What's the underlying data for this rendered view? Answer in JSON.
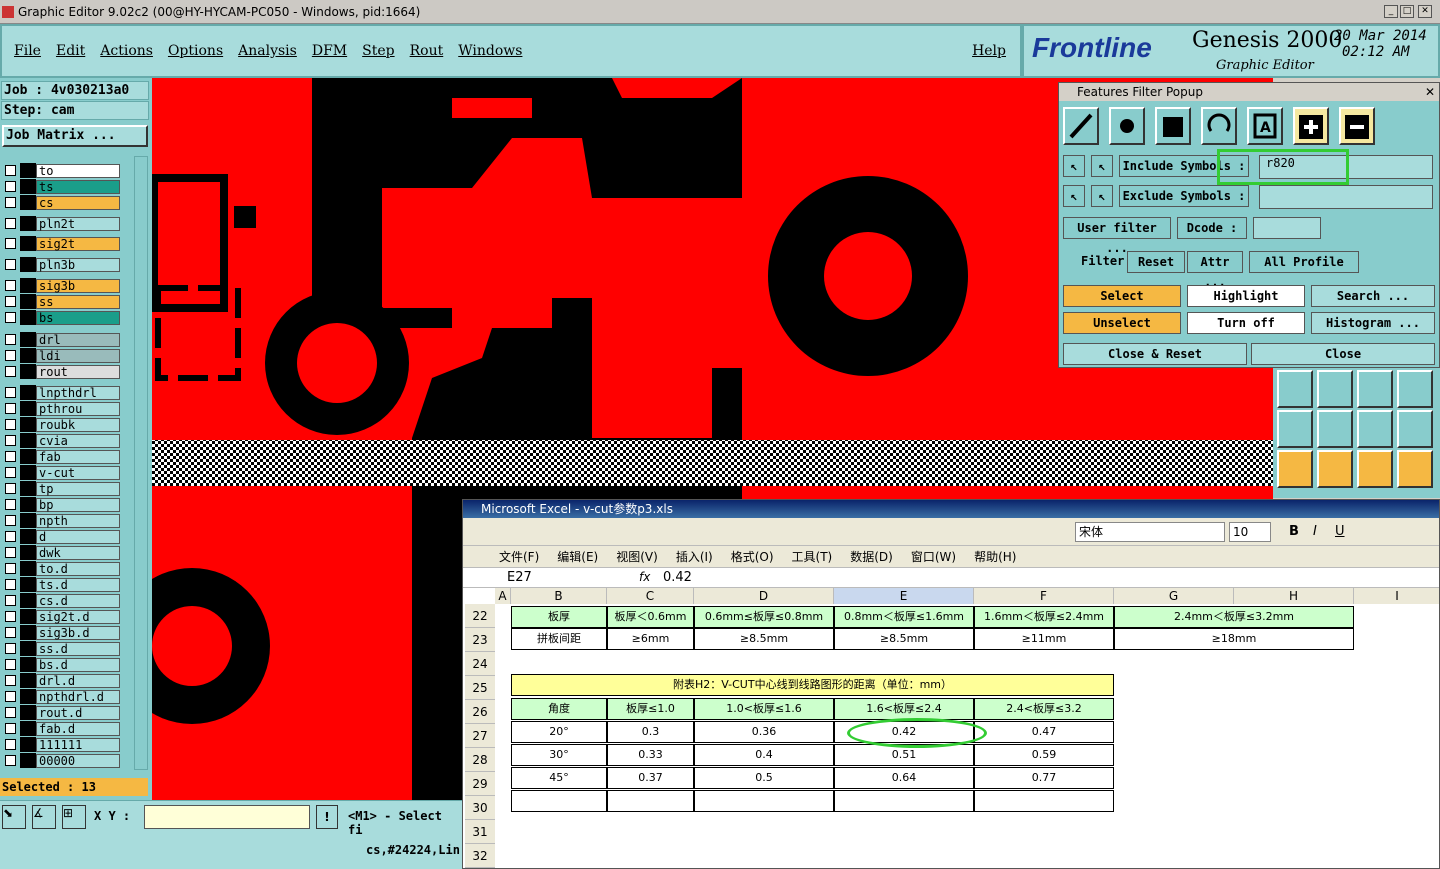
{
  "window": {
    "title": "Graphic Editor 9.02c2 (00@HY-HYCAM-PC050 - Windows, pid:1664)"
  },
  "menu": [
    "File",
    "Edit",
    "Actions",
    "Options",
    "Analysis",
    "DFM",
    "Step",
    "Rout",
    "Windows"
  ],
  "help": "Help",
  "brand": {
    "logo": "Frontline",
    "product": "Genesis 2000",
    "sub": "Graphic Editor",
    "date": "20 Mar 2014",
    "time": "02:12 AM"
  },
  "job": {
    "job": "Job : 4v030213a0",
    "step": "Step: cam",
    "matrix": "Job Matrix ..."
  },
  "layers": [
    "to",
    "ts",
    "cs",
    "pln2t",
    "sig2t",
    "pln3b",
    "sig3b",
    "ss",
    "bs",
    "drl",
    "ldi",
    "rout",
    "lnpthdrl",
    "pthrou",
    "roubk",
    "cvia",
    "fab",
    "v-cut",
    "tp",
    "bp",
    "npth",
    "d",
    "dwk",
    "to.d",
    "ts.d",
    "cs.d",
    "sig2t.d",
    "sig3b.d",
    "ss.d",
    "bs.d",
    "drl.d",
    "npthdrl.d",
    "rout.d",
    "fab.d",
    "111111",
    "00000"
  ],
  "selected": "Selected : 13",
  "xy_label": "X Y :",
  "mouse_hint": "<M1> - Select fi",
  "status_text": "cs,#24224,Lin",
  "popup": {
    "title": "Features Filter Popup",
    "include_label": "Include Symbols :",
    "include_value": "r820",
    "exclude_label": "Exclude Symbols :",
    "user_filter": "User filter ...",
    "dcode": "Dcode :",
    "filter": "Filter",
    "reset": "Reset",
    "attr": "Attr ...",
    "profile": "All Profile",
    "select": "Select",
    "highlight": "Highlight",
    "search": "Search ...",
    "unselect": "Unselect",
    "turnoff": "Turn off",
    "histogram": "Histogram ...",
    "close_reset": "Close & Reset",
    "close": "Close"
  },
  "excel": {
    "title": "Microsoft Excel - v-cut参数p3.xls",
    "font": "宋体",
    "size": "10",
    "menu": [
      "文件(F)",
      "编辑(E)",
      "视图(V)",
      "插入(I)",
      "格式(O)",
      "工具(T)",
      "数据(D)",
      "窗口(W)",
      "帮助(H)"
    ],
    "cellref": "E27",
    "fx": "fx",
    "formula": "0.42",
    "cols": [
      "A",
      "B",
      "C",
      "D",
      "E",
      "F",
      "G",
      "H",
      "I"
    ],
    "rows": [
      "22",
      "23",
      "24",
      "25",
      "26",
      "27",
      "28",
      "29",
      "30",
      "31",
      "32"
    ],
    "t1_r1": [
      "板厚",
      "板厚＜0.6mm",
      "0.6mm≤板厚≤0.8mm",
      "0.8mm＜板厚≤1.6mm",
      "1.6mm＜板厚≤2.4mm",
      "2.4mm＜板厚≤3.2mm"
    ],
    "t1_r2": [
      "拼板间距",
      "≥6mm",
      "≥8.5mm",
      "≥8.5mm",
      "≥11mm",
      "≥18mm"
    ],
    "t2_title": "附表H2：V-CUT中心线到线路图形的距离（单位：mm）",
    "t2_head": [
      "角度",
      "板厚≤1.0",
      "1.0<板厚≤1.6",
      "1.6<板厚≤2.4",
      "2.4<板厚≤3.2"
    ],
    "t2_r1": [
      "20°",
      "0.3",
      "0.36",
      "0.42",
      "0.47"
    ],
    "t2_r2": [
      "30°",
      "0.33",
      "0.4",
      "0.51",
      "0.59"
    ],
    "t2_r3": [
      "45°",
      "0.37",
      "0.5",
      "0.64",
      "0.77"
    ]
  }
}
